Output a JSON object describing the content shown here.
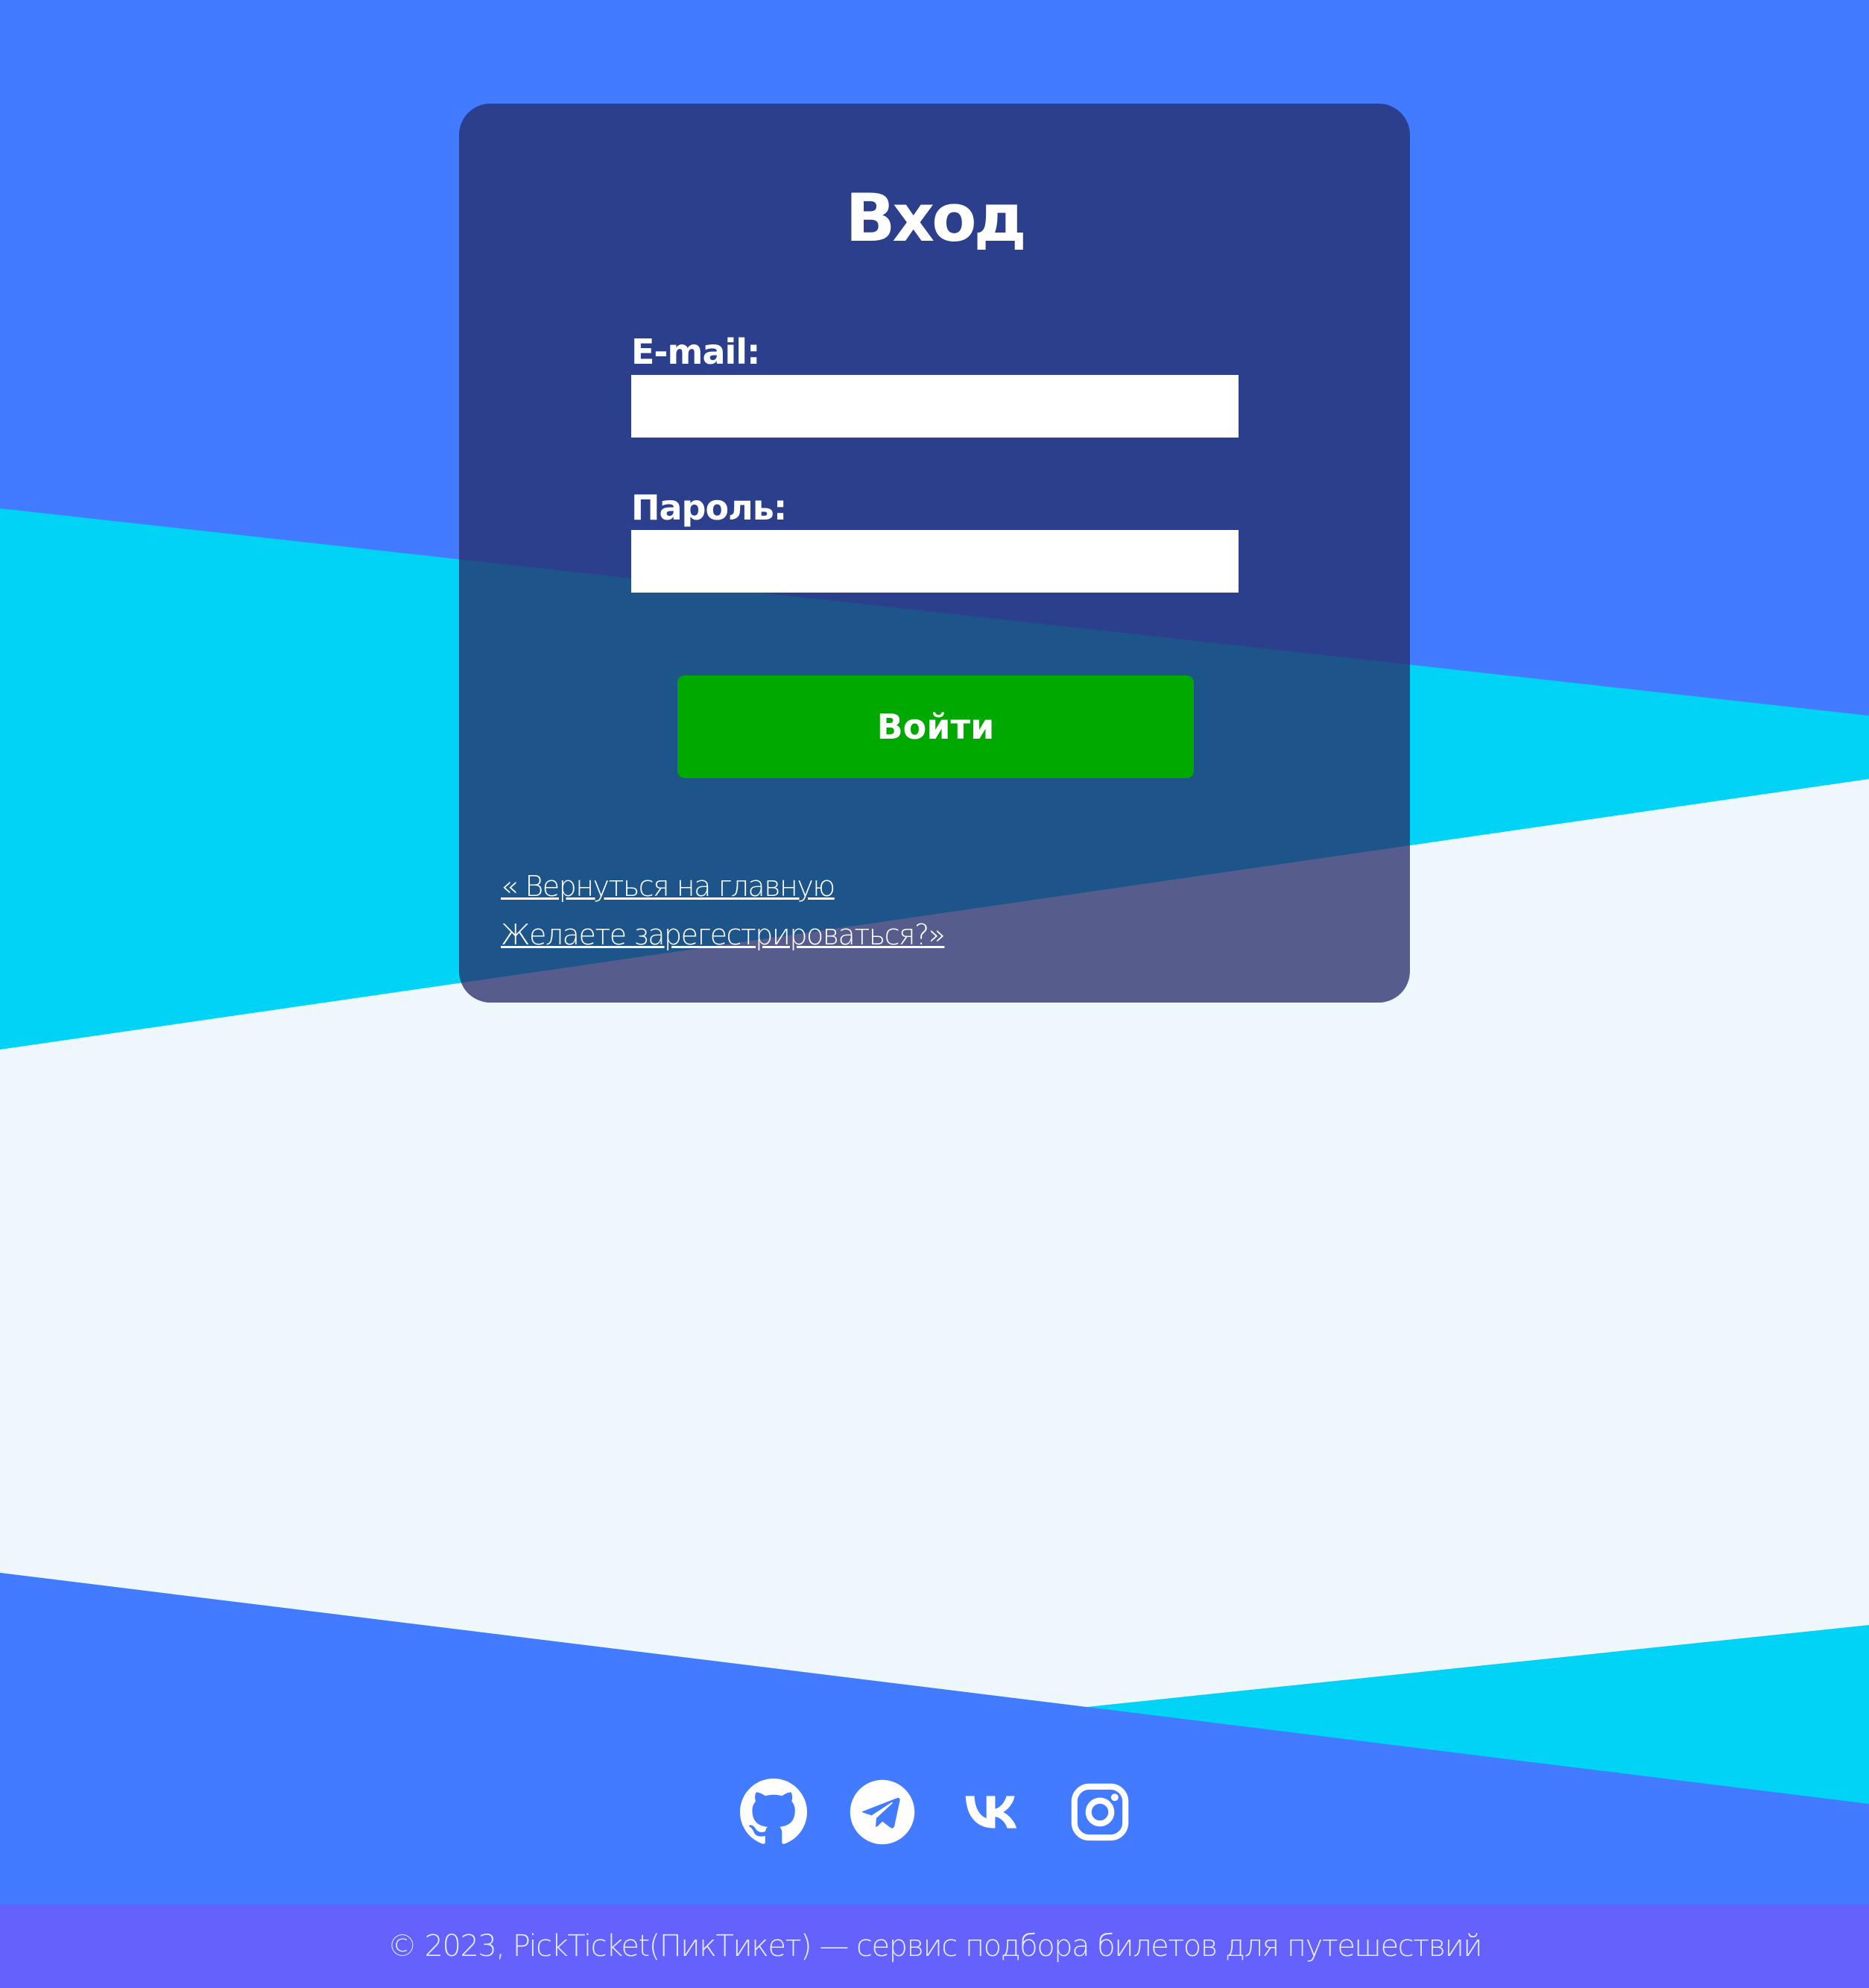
{
  "colors": {
    "background_primary": "#427bff",
    "background_accent": "#00d3f5",
    "background_light": "#eef7fc",
    "card": "#262d68",
    "button": "#00a900",
    "footer": "#6561fc",
    "text": "#ffffff"
  },
  "login": {
    "title": "Вход",
    "email_label": "E-mail:",
    "email_value": "",
    "password_label": "Пароль:",
    "password_value": "",
    "submit_label": "Войти",
    "back_link": "« Вернуться на главную",
    "register_link": "Желаете зарегестрироваться?»"
  },
  "social": [
    {
      "name": "GitHub",
      "icon": "github-icon"
    },
    {
      "name": "Telegram",
      "icon": "telegram-icon"
    },
    {
      "name": "VK",
      "icon": "vk-icon"
    },
    {
      "name": "Instagram",
      "icon": "instagram-icon"
    }
  ],
  "footer": {
    "copyright": "© 2023, PickTicket(ПикТикет) — сервис подбора билетов для путешествий"
  }
}
